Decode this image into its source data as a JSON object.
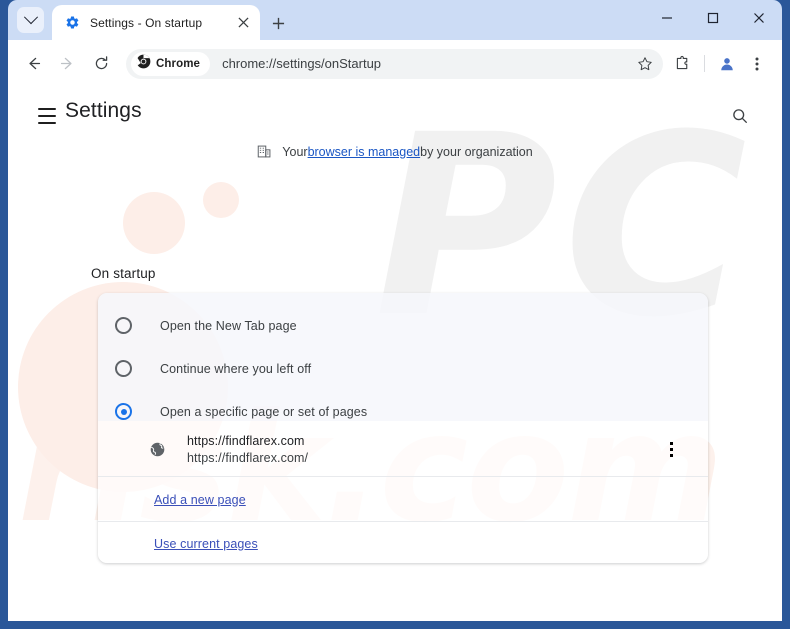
{
  "window": {
    "frame_color": "#2a5799",
    "controls": {
      "minimize": "minimize",
      "maximize": "maximize",
      "close": "close"
    }
  },
  "tabstrip": {
    "tab_search_label": "Search tabs",
    "tabs": [
      {
        "title": "Settings - On startup",
        "favicon": "gear-icon",
        "close_label": "Close"
      }
    ],
    "new_tab_label": "New Tab"
  },
  "toolbar": {
    "back_label": "Back",
    "forward_label": "Forward",
    "reload_label": "Reload",
    "chrome_chip_label": "Chrome",
    "url": "chrome://settings/onStartup",
    "bookmark_label": "Bookmark this tab",
    "extensions_label": "Extensions",
    "profile_label": "Profile",
    "menu_label": "Customize and control Google Chrome"
  },
  "settings": {
    "menu_label": "Main menu",
    "title": "Settings",
    "search_label": "Search settings",
    "managed_banner": {
      "icon": "building-icon",
      "prefix": "Your ",
      "link": "browser is managed",
      "suffix": " by your organization"
    },
    "section_title": "On startup",
    "startup_options": [
      {
        "label": "Open the New Tab page",
        "selected": false
      },
      {
        "label": "Continue where you left off",
        "selected": false
      },
      {
        "label": "Open a specific page or set of pages",
        "selected": true
      }
    ],
    "startup_pages": [
      {
        "favicon": "globe-icon",
        "title": "https://findflarex.com",
        "url": "https://findflarex.com/",
        "more_label": "More actions"
      }
    ],
    "add_page_link": "Add a new page",
    "use_current_link": "Use current pages",
    "accent_color": "#1a73e8",
    "link_color": "#3a4fb8"
  },
  "watermark": {
    "top_text": "PC",
    "bottom_text": "risk.com"
  }
}
